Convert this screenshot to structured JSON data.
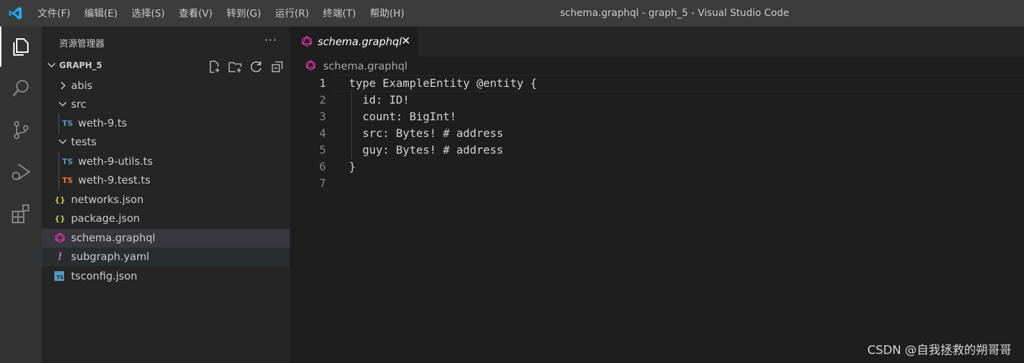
{
  "window": {
    "title": "schema.graphql - graph_5 - Visual Studio Code"
  },
  "menu": [
    "文件(F)",
    "编辑(E)",
    "选择(S)",
    "查看(V)",
    "转到(G)",
    "运行(R)",
    "终端(T)",
    "帮助(H)"
  ],
  "activity_bar": {
    "items": [
      "explorer-icon",
      "search-icon",
      "source-control-icon",
      "run-debug-icon",
      "extensions-icon"
    ],
    "active": "explorer-icon"
  },
  "sidebar": {
    "title": "资源管理器",
    "more": "···",
    "section": "GRAPH_5",
    "tree": [
      {
        "label": "abis",
        "type": "folder",
        "expanded": false,
        "depth": 0
      },
      {
        "label": "src",
        "type": "folder",
        "expanded": true,
        "depth": 0
      },
      {
        "label": "weth-9.ts",
        "type": "ts",
        "depth": 1,
        "badge": "TS"
      },
      {
        "label": "tests",
        "type": "folder",
        "expanded": true,
        "depth": 0
      },
      {
        "label": "weth-9-utils.ts",
        "type": "ts",
        "depth": 1,
        "badge": "TS"
      },
      {
        "label": "weth-9.test.ts",
        "type": "ts-test",
        "depth": 1,
        "badge": "TS"
      },
      {
        "label": "networks.json",
        "type": "json",
        "depth": 0,
        "badge": "{}"
      },
      {
        "label": "package.json",
        "type": "json",
        "depth": 0,
        "badge": "{}"
      },
      {
        "label": "schema.graphql",
        "type": "graphql",
        "depth": 0,
        "selected": true
      },
      {
        "label": "subgraph.yaml",
        "type": "yaml",
        "depth": 0,
        "badge": "!"
      },
      {
        "label": "tsconfig.json",
        "type": "tsconfig",
        "depth": 0,
        "badge": "TS"
      }
    ]
  },
  "editor": {
    "tab": {
      "label": "schema.graphql",
      "close": "✕"
    },
    "breadcrumb": "schema.graphql",
    "current_line": 1,
    "lines": [
      {
        "n": "1",
        "text": "type ExampleEntity @entity {"
      },
      {
        "n": "2",
        "text": "  id: ID!"
      },
      {
        "n": "3",
        "text": "  count: BigInt!"
      },
      {
        "n": "4",
        "text": "  src: Bytes! # address"
      },
      {
        "n": "5",
        "text": "  guy: Bytes! # address"
      },
      {
        "n": "6",
        "text": "}"
      },
      {
        "n": "7",
        "text": ""
      }
    ]
  },
  "colors": {
    "accent_blue": "#23a9f2",
    "ts_blue": "#519aba",
    "ts_orange": "#e37933",
    "json_yellow": "#cbcb41",
    "graphql_pink": "#e535ab",
    "yaml_purple": "#a074c4"
  },
  "watermark": "CSDN @自我拯救的朔哥哥"
}
